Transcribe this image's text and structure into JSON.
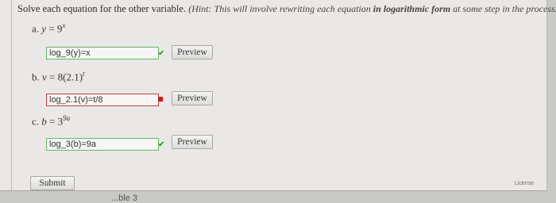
{
  "instructions": {
    "text": "Solve each equation for the other variable.",
    "hint_open": "(Hint: ",
    "hint_text": "This will involve rewriting each equation ",
    "hint_bold": "in logarithmic form",
    "hint_tail": " at some step in the process.)"
  },
  "problems": [
    {
      "letter": "a.",
      "var": "y",
      "eq": " = 9",
      "exp": "x",
      "tail": "",
      "answer": "log_9(y)=x",
      "status": "correct",
      "preview_label": "Preview"
    },
    {
      "letter": "b.",
      "var": "v",
      "eq": " = 8(2.1)",
      "exp": "t",
      "tail": "",
      "answer": "log_2.1(v)=t/8",
      "status": "incorrect",
      "preview_label": "Preview"
    },
    {
      "letter": "c.",
      "var": "b",
      "eq": " = 3",
      "exp": "9a",
      "tail": "",
      "answer": "log_3(b)=9a",
      "status": "correct",
      "preview_label": "Preview"
    }
  ],
  "icons": {
    "correct": "checkmark-icon",
    "incorrect": "x-square-icon",
    "correct_glyph": "✔",
    "correct_color": "#1d8a1d",
    "incorrect_color": "#c21e1e"
  },
  "submit_label": "Submit",
  "license_label": "License",
  "cut_text": "...ble 3"
}
